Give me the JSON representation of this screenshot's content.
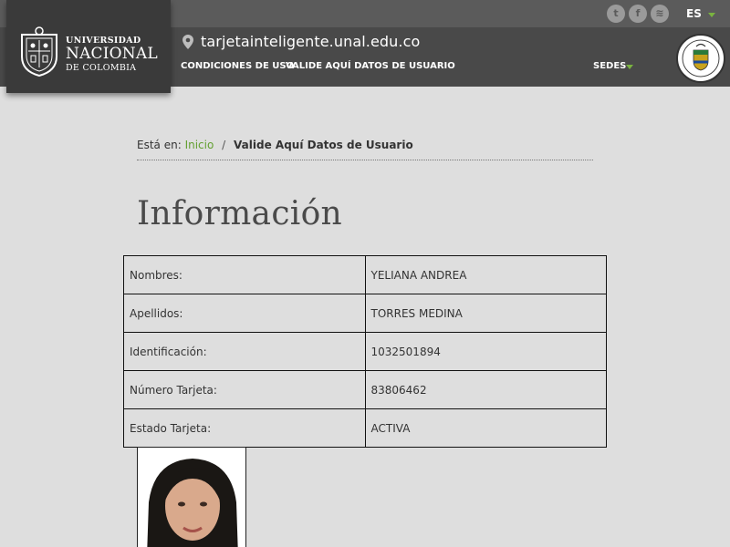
{
  "header": {
    "logo": {
      "line1": "UNIVERSIDAD",
      "line2": "NACIONAL",
      "line3": "DE COLOMBIA"
    },
    "social": [
      {
        "name": "twitter-icon",
        "glyph": "t"
      },
      {
        "name": "facebook-icon",
        "glyph": "f"
      },
      {
        "name": "rss-icon",
        "glyph": "≋"
      }
    ],
    "language": "ES",
    "site_url": "tarjetainteligente.unal.edu.co",
    "nav": [
      "CONDICIONES DE USO",
      "VALIDE AQUÍ DATOS DE USUARIO"
    ],
    "sedes": "SEDES",
    "accent_color": "#7ab340"
  },
  "breadcrumb": {
    "prefix": "Está en:",
    "home": "Inicio",
    "separator": "/",
    "current": "Valide Aquí Datos de Usuario"
  },
  "page_title": "Información",
  "info_table": [
    {
      "label": "Nombres:",
      "value": "YELIANA ANDREA"
    },
    {
      "label": "Apellidos:",
      "value": "TORRES MEDINA"
    },
    {
      "label": "Identificación:",
      "value": "1032501894"
    },
    {
      "label": "Número Tarjeta:",
      "value": "83806462"
    },
    {
      "label": "Estado Tarjeta:",
      "value": "ACTIVA"
    }
  ]
}
